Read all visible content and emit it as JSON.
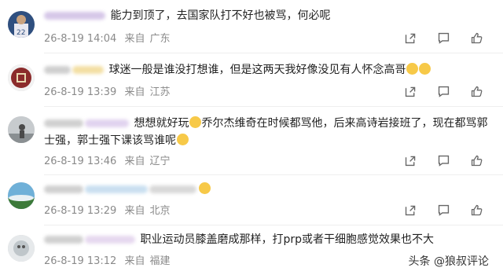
{
  "comments": [
    {
      "text": "能力到顶了，去国家队打不好也被骂，何必呢",
      "date": "26-8-19 14:04",
      "from_label": "来自",
      "location": "广东",
      "avatar_color": "#3b5a8a"
    },
    {
      "text": "球迷一般是谁没打想谁，但是这两天我好像没见有人怀念高哥",
      "date": "26-8-19 13:39",
      "from_label": "来自",
      "location": "江苏",
      "avatar_color": "#8b2b2b"
    },
    {
      "text_line1": "想想就好玩",
      "text_line1b": "乔尔杰维奇在时候都骂他，后来高诗岩接班了，现在都骂郭",
      "text_line2": "士强，郭士强下课该骂谁呢",
      "date": "26-8-19 13:46",
      "from_label": "来自",
      "location": "辽宁",
      "avatar_color": "#9aa3a8"
    },
    {
      "date": "26-8-19 13:29",
      "from_label": "来自",
      "location": "北京",
      "avatar_color": "#4a8fb8"
    },
    {
      "text": "职业运动员膝盖磨成那样，打prp或者干细胞感觉效果也不大",
      "date": "26-8-19 13:12",
      "from_label": "来自",
      "location": "福建",
      "avatar_color": "#d8dde0"
    }
  ],
  "watermark": "头条 @狼叔评论",
  "icons": [
    "share-icon",
    "comment-icon",
    "like-icon"
  ]
}
